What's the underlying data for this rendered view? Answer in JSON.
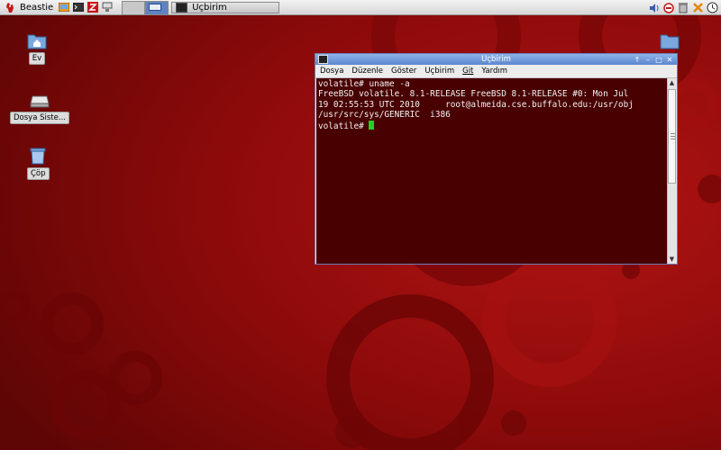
{
  "panel": {
    "menu_label": "Beastie",
    "launchers": [
      "image-viewer-icon",
      "terminal-icon",
      "filezilla-icon",
      "network-icon"
    ],
    "workspaces": 2,
    "active_workspace": 1,
    "task_button_label": "Uçbirim",
    "tray_icons": [
      "volume-icon",
      "stop-icon",
      "trash-tray-icon",
      "tools-icon",
      "clock-icon"
    ]
  },
  "desktop": {
    "icons": [
      {
        "label": "Ev",
        "icon": "home-folder-icon"
      },
      {
        "label": "Dosya Siste...",
        "icon": "drive-icon"
      },
      {
        "label": "Çöp",
        "icon": "trash-icon"
      },
      {
        "label": "",
        "icon": "folder-icon"
      }
    ]
  },
  "terminal": {
    "title": "Uçbirim",
    "menu": [
      "Dosya",
      "Düzenle",
      "Göster",
      "Uçbirim",
      "Git",
      "Yardım"
    ],
    "lines": [
      "volatile# uname -a",
      "FreeBSD volatile. 8.1-RELEASE FreeBSD 8.1-RELEASE #0: Mon Jul",
      "19 02:55:53 UTC 2010     root@almeida.cse.buffalo.edu:/usr/obj",
      "/usr/src/sys/GENERIC  i386"
    ],
    "prompt": "volatile# "
  },
  "colors": {
    "background": "#8c0a0a",
    "terminal_bg": "#480000",
    "cursor": "#1fd21f",
    "titlebar": "#5b86cf"
  }
}
